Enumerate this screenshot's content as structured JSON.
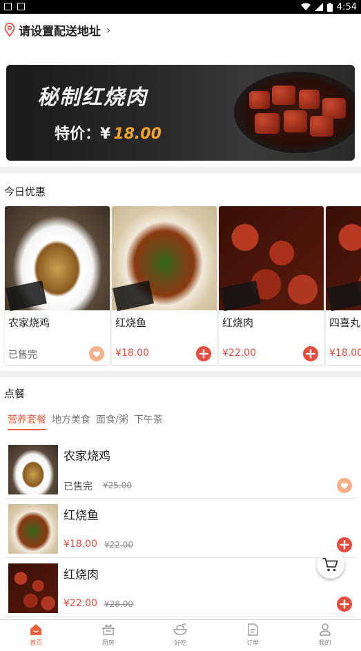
{
  "status_bar": {
    "time": "4:54"
  },
  "address": {
    "label": "请设置配送地址",
    "chevron": "›"
  },
  "banner": {
    "title": "秘制红烧肉",
    "price_label": "特价：¥",
    "price_value": "18.00"
  },
  "deals": {
    "section_title": "今日优惠",
    "items": [
      {
        "name": "农家烧鸡",
        "status": "已售完"
      },
      {
        "name": "红烧鱼",
        "price": "¥18.00"
      },
      {
        "name": "红烧肉",
        "price": "¥22.00"
      },
      {
        "name": "四喜丸",
        "price": "¥18.00"
      }
    ]
  },
  "menu": {
    "section_title": "点餐",
    "tabs": [
      "营养套餐",
      "地方美食",
      "面食/粥",
      "下午茶"
    ],
    "items": [
      {
        "name": "农家烧鸡",
        "status": "已售完",
        "original_price": "¥25.00"
      },
      {
        "name": "红烧鱼",
        "price": "¥18.00",
        "original_price": "¥22.00"
      },
      {
        "name": "红烧肉",
        "price": "¥22.00",
        "original_price": "¥28.00"
      }
    ]
  },
  "bottom_nav": [
    {
      "label": "首页",
      "icon": "home-icon",
      "active": true
    },
    {
      "label": "厨房",
      "icon": "kitchen-icon"
    },
    {
      "label": "好吃",
      "icon": "bowl-icon"
    },
    {
      "label": "订单",
      "icon": "order-icon"
    },
    {
      "label": "我的",
      "icon": "profile-icon"
    }
  ],
  "colors": {
    "accent": "#e8603c",
    "price": "#e84c3d",
    "banner_price": "#f4a428"
  }
}
